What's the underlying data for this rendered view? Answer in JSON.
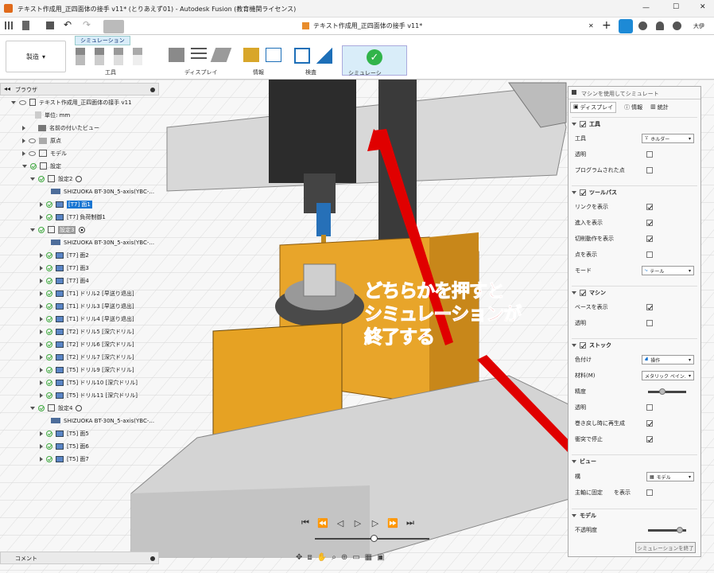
{
  "window": {
    "title": "テキスト作成用_正四面体の接手 v11* (とりあえず01) - Autodesk Fusion (教育機関ライセンス)",
    "minimize": "—",
    "maximize": "☐",
    "close": "✕"
  },
  "tab": {
    "title": "テキスト作成用_正四面体の接手 v11*",
    "close": "✕",
    "user": "大伊"
  },
  "ribbon": {
    "workspace_label": "製造",
    "sim_tab": "シミュレーション",
    "groups": [
      "工具",
      "ディスプレイ",
      "情報",
      "検査",
      "シミュレーションを終了"
    ],
    "finish_group_visible": "シミュレーシ"
  },
  "browser": {
    "title": "ブラウザ",
    "root": "テキスト作成用_正四面体の接手 v11",
    "items": [
      {
        "label": "単位: mm"
      },
      {
        "label": "名前の付いたビュー"
      },
      {
        "label": "原点"
      },
      {
        "label": "モデル"
      },
      {
        "label": "設定"
      },
      {
        "label": "設定2"
      },
      {
        "label": "SHIZUOKA BT-30N_5-axis(YBC-..."
      },
      {
        "label": "[T7] 面1"
      },
      {
        "label": "[T7] 負荷制御1"
      },
      {
        "label": "設定3"
      },
      {
        "label": "SHIZUOKA BT-30N_5-axis(YBC-..."
      },
      {
        "label": "[T7] 面2"
      },
      {
        "label": "[T7] 面3"
      },
      {
        "label": "[T7] 面4"
      },
      {
        "label": "[T1] ドリル2 [早送り退出]"
      },
      {
        "label": "[T1] ドリル3 [早送り退出]"
      },
      {
        "label": "[T1] ドリル4 [早送り退出]"
      },
      {
        "label": "[T2] ドリル5 [深穴ドリル]"
      },
      {
        "label": "[T2] ドリル6 [深穴ドリル]"
      },
      {
        "label": "[T2] ドリル7 [深穴ドリル]"
      },
      {
        "label": "[T5] ドリル9 [深穴ドリル]"
      },
      {
        "label": "[T5] ドリル10 [深穴ドリル]"
      },
      {
        "label": "[T5] ドリル11 [深穴ドリル]"
      },
      {
        "label": "設定4"
      },
      {
        "label": "SHIZUOKA BT-30N_5-axis(YBC-..."
      },
      {
        "label": "[T5] 面5"
      },
      {
        "label": "[T5] 面6"
      },
      {
        "label": "[T5] 面7"
      }
    ],
    "comment": "コメント"
  },
  "panel": {
    "title": "マシンを使用してシミュレート",
    "tabs": [
      "ディスプレイ",
      "情報",
      "統計"
    ],
    "tool_section": "工具",
    "tool_rows": [
      "工具",
      "透明",
      "プログラムされた点"
    ],
    "tool_select": "ホルダー",
    "toolpath_section": "ツールパス",
    "toolpath_rows": [
      "リンクを表示",
      "進入を表示",
      "切削動作を表示",
      "点を表示",
      "モード"
    ],
    "mode_select": "テール",
    "machine_section": "マシン",
    "machine_rows": [
      "ベースを表示",
      "透明"
    ],
    "stock_section": "ストック",
    "stock_rows": [
      "色付け",
      "材料(M)",
      "精度",
      "透明",
      "巻き戻し時に再生成",
      "衝突で停止"
    ],
    "color_select": "操作",
    "material_select": "メタリック ペイン...",
    "view_section": "ビュー",
    "view_rows": [
      "構",
      "主軸に固定",
      "を表示"
    ],
    "view_select": "モデル",
    "model_section": "モデル",
    "model_rows": [
      "不透明度"
    ],
    "finish_button": "シミュレーションを終了"
  },
  "overlay": {
    "lines": [
      "どちらかを押すと",
      "シミュレーションが",
      "終了する"
    ]
  },
  "colors": {
    "arrow": "#e00000",
    "accent": "#1976d2",
    "block": "#e8a52a"
  }
}
